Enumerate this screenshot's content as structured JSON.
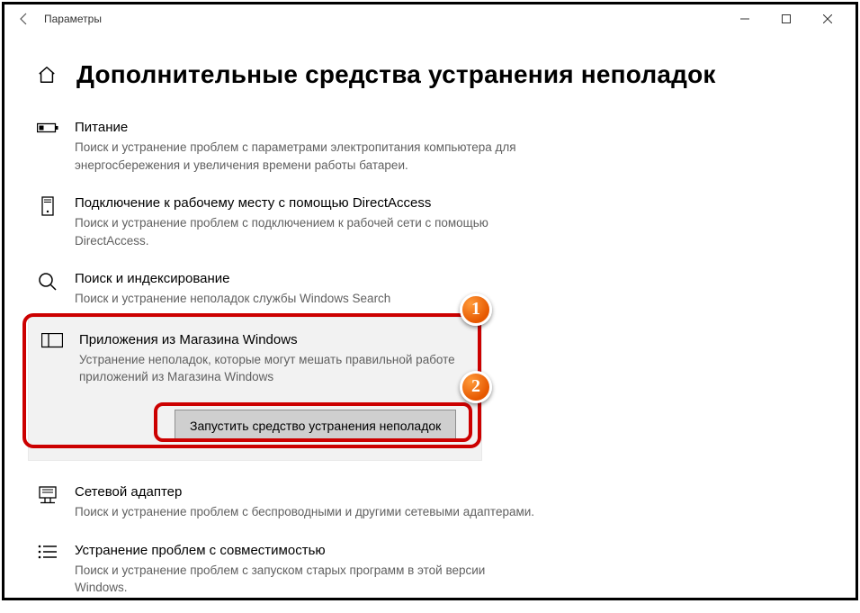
{
  "window": {
    "title": "Параметры"
  },
  "page": {
    "heading": "Дополнительные средства устранения неполадок"
  },
  "items": {
    "power": {
      "title": "Питание",
      "desc": "Поиск и устранение проблем с параметрами электропитания компьютера для энергосбережения и увеличения  времени работы батареи."
    },
    "directaccess": {
      "title": "Подключение к рабочему месту с помощью DirectAccess",
      "desc": "Поиск и устранение проблем с подключением к рабочей сети с помощью DirectAccess."
    },
    "search": {
      "title": "Поиск и индексирование",
      "desc": "Поиск и устранение неполадок службы Windows Search"
    },
    "store": {
      "title": "Приложения из Магазина Windows",
      "desc": "Устранение неполадок, которые могут мешать правильной работе приложений из Магазина Windows"
    },
    "network": {
      "title": "Сетевой адаптер",
      "desc": "Поиск и устранение проблем с беспроводными и другими сетевыми адаптерами."
    },
    "compat": {
      "title": "Устранение проблем с совместимостью",
      "desc": "Поиск и устранение проблем с запуском старых программ в этой версии Windows."
    }
  },
  "actions": {
    "run": "Запустить средство устранения неполадок"
  },
  "badges": {
    "one": "1",
    "two": "2"
  }
}
